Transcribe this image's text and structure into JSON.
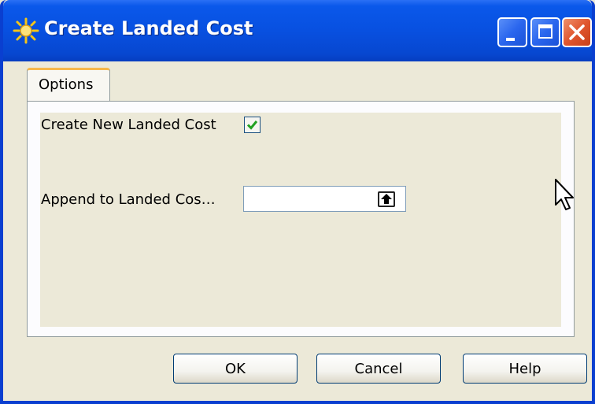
{
  "window": {
    "title": "Create Landed Cost",
    "controls": {
      "minimize": "minimize-icon",
      "maximize": "maximize-icon",
      "close": "close-icon"
    }
  },
  "tabs": [
    {
      "label": "Options",
      "selected": true
    }
  ],
  "options": {
    "create_new_label": "Create New Landed Cost",
    "create_new_checked": true,
    "append_label": "Append to Landed Cos…",
    "append_value": ""
  },
  "buttons": {
    "ok": "OK",
    "cancel": "Cancel",
    "help": "Help"
  }
}
